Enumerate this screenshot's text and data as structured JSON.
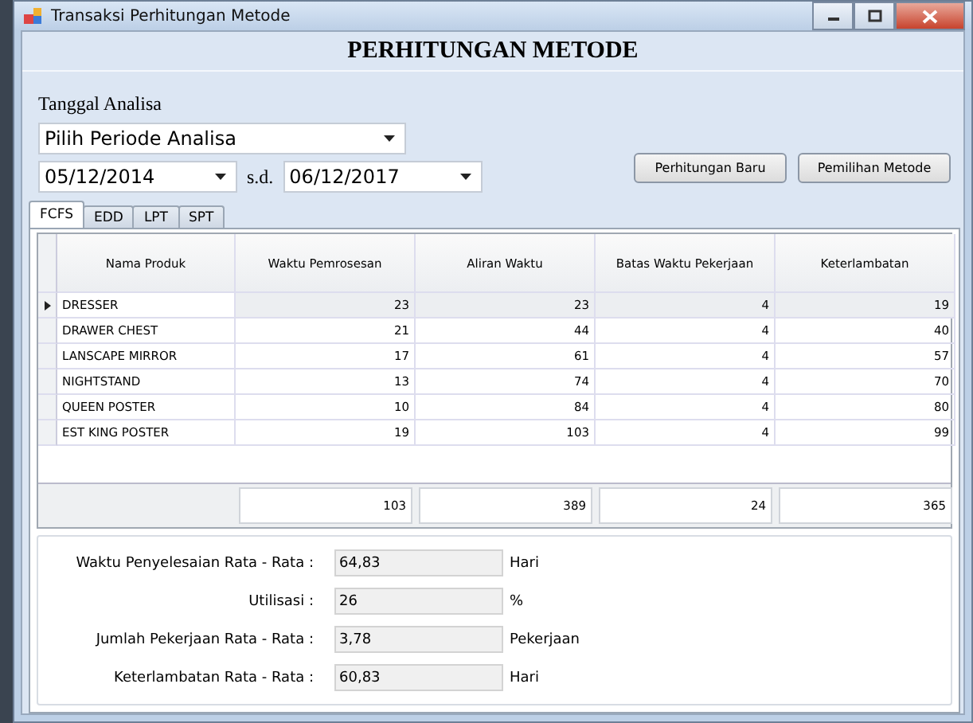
{
  "window": {
    "title": "Transaksi Perhitungan Metode"
  },
  "header": "PERHITUNGAN METODE",
  "date_section": {
    "label": "Tanggal Analisa",
    "period": "Pilih Periode Analisa",
    "start": "05/12/2014",
    "separator": "s.d.",
    "end": "06/12/2017"
  },
  "buttons": [
    "Perhitungan Baru",
    "Pemilihan Metode"
  ],
  "tabs": [
    {
      "label": "FCFS",
      "selected": true
    },
    {
      "label": "EDD",
      "selected": false
    },
    {
      "label": "LPT",
      "selected": false
    },
    {
      "label": "SPT",
      "selected": false
    }
  ],
  "table": {
    "columns": [
      "Nama Produk",
      "Waktu Pemrosesan",
      "Aliran Waktu",
      "Batas Waktu Pekerjaan",
      "Keterlambatan"
    ],
    "rows": [
      {
        "cells": [
          "DRESSER",
          "23",
          "23",
          "4",
          "19"
        ],
        "selected": true
      },
      {
        "cells": [
          "DRAWER CHEST",
          "21",
          "44",
          "4",
          "40"
        ],
        "selected": false
      },
      {
        "cells": [
          "LANSCAPE MIRROR",
          "17",
          "61",
          "4",
          "57"
        ],
        "selected": false
      },
      {
        "cells": [
          "NIGHTSTAND",
          "13",
          "74",
          "4",
          "70"
        ],
        "selected": false
      },
      {
        "cells": [
          "QUEEN POSTER",
          "10",
          "84",
          "4",
          "80"
        ],
        "selected": false
      },
      {
        "cells": [
          "EST KING POSTER",
          "19",
          "103",
          "4",
          "99"
        ],
        "selected": false
      }
    ],
    "totals": [
      "103",
      "389",
      "24",
      "365"
    ]
  },
  "summary": [
    {
      "label": "Waktu Penyelesaian Rata - Rata :",
      "value": "64,83",
      "unit": "Hari"
    },
    {
      "label": "Utilisasi :",
      "value": "26",
      "unit": "%"
    },
    {
      "label": "Jumlah Pekerjaan Rata - Rata :",
      "value": "3,78",
      "unit": "Pekerjaan"
    },
    {
      "label": "Keterlambatan Rata - Rata :",
      "value": "60,83",
      "unit": "Hari"
    }
  ]
}
